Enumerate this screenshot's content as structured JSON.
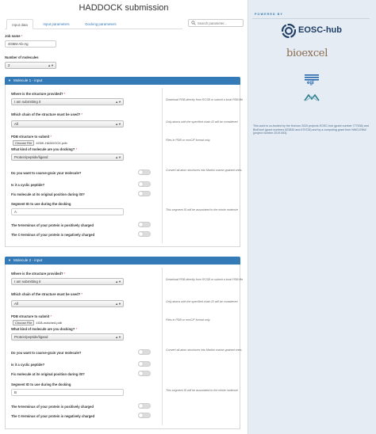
{
  "page": {
    "title": "HADDOCK submission"
  },
  "tabs": [
    {
      "label": "Input data",
      "active": true
    },
    {
      "label": "Input parameters",
      "active": false
    },
    {
      "label": "Docking parameters",
      "active": false
    }
  ],
  "search": {
    "placeholder": "Search parameter..."
  },
  "job": {
    "label": "Job name",
    "value": "4G6M-Ab-Ag"
  },
  "molecules_count": {
    "label": "Number of molecules",
    "value": "2"
  },
  "common": {
    "provided_label": "Where is the structure provided?",
    "provided_hint": "Download PDB directly from RCSB or submit a local PDB file",
    "chain_label": "Which chain of the structure must be used?",
    "chain_hint": "Only atoms with the specified chain ID will be considered",
    "pdb_label": "PDB structure to submit",
    "pdb_hint": "Files in PDB or mmCIF format only.",
    "choose_file": "Choose File",
    "kind_label": "What kind of molecule are you docking?",
    "coarse_label": "Do you want to coarse-grain your molecule?",
    "coarse_hint": "Convert all-atom structures into Martini coarse-grained ones.",
    "cyclic_label": "Is it a cyclic peptide?",
    "fix_label": "Fix molecule at its original position during it0?",
    "segid_label": "Segment ID to use during the docking",
    "segid_hint": "This segment ID will be associated to the whole molecule",
    "nterm_label": "The N-terminus of your protein is positively charged",
    "cterm_label": "The C-terminus of your protein is negatively charged",
    "required_mark": "*"
  },
  "molecules": [
    {
      "header": "Molecule 1 - input",
      "provided_value": "I am submitting it",
      "chain_value": "All",
      "file_name": "4G6K-HADDOCK.pdb",
      "kind_value": "Protein/peptide/ligand",
      "segid_value": "A"
    },
    {
      "header": "Molecule 2 - input",
      "provided_value": "I am submitting it",
      "chain_value": "All",
      "file_name": "4I1B-matched.pdb",
      "kind_value": "Protein/peptide/ligand",
      "segid_value": "B"
    }
  ],
  "sidebar": {
    "powered_by": "POWERED BY",
    "logos": [
      "EOSC-hub",
      "bioexcel",
      "egi"
    ],
    "funding": "This work is co-funded by the Horizon 2020 projects EOSC-hub (grant number 777536) and BioExcel (grant numbers 823830 and 675728) and by a computing grant from NWO-ENW (project number 2019.053)."
  },
  "colors": {
    "primary": "#337ab7",
    "sidebar_bg": "#e5ecf3",
    "eosc": "#1f3e66"
  }
}
